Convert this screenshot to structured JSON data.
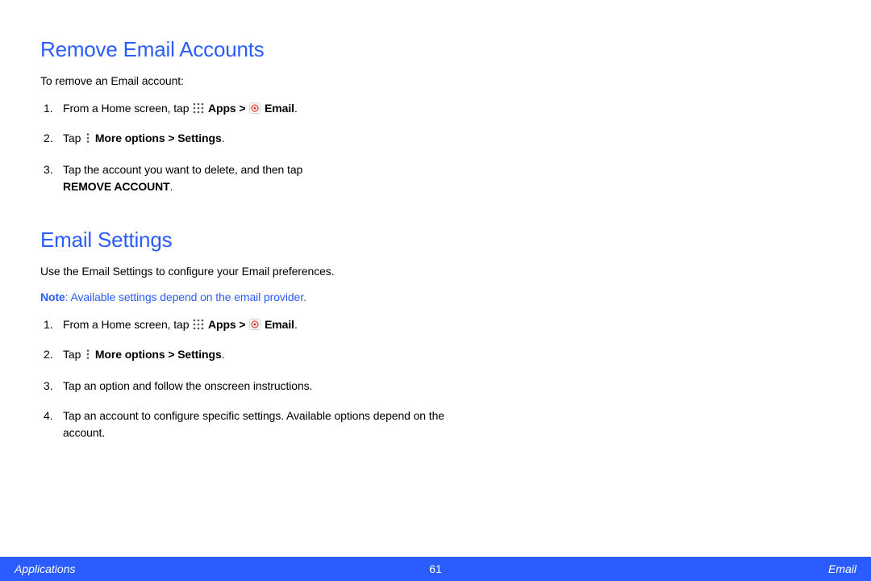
{
  "section1": {
    "heading": "Remove Email Accounts",
    "intro": "To remove an Email account:",
    "steps": {
      "s1": {
        "prefix": "From a Home screen, tap ",
        "apps": "Apps > ",
        "email": " Email",
        "period": "."
      },
      "s2": {
        "prefix": "Tap ",
        "bold": "More options > Settings",
        "period": "."
      },
      "s3": {
        "line1": "Tap the account you want to delete, and then tap ",
        "removeAccount": "REMOVE ACCOUNT",
        "period": "."
      }
    }
  },
  "section2": {
    "heading": "Email Settings",
    "intro": "Use the Email Settings to configure your Email preferences.",
    "note": {
      "label": "Note",
      "text": ": Available settings depend on the email provider."
    },
    "steps": {
      "s1": {
        "prefix": "From a Home screen, tap ",
        "apps": "Apps > ",
        "email": " Email",
        "period": "."
      },
      "s2": {
        "prefix": "Tap ",
        "bold": "More options > Settings",
        "period": "."
      },
      "s3": "Tap an option and follow the onscreen instructions.",
      "s4": "Tap an account to configure specific settings. Available options depend on the account."
    }
  },
  "footer": {
    "left": "Applications",
    "center": "61",
    "right": "Email"
  }
}
